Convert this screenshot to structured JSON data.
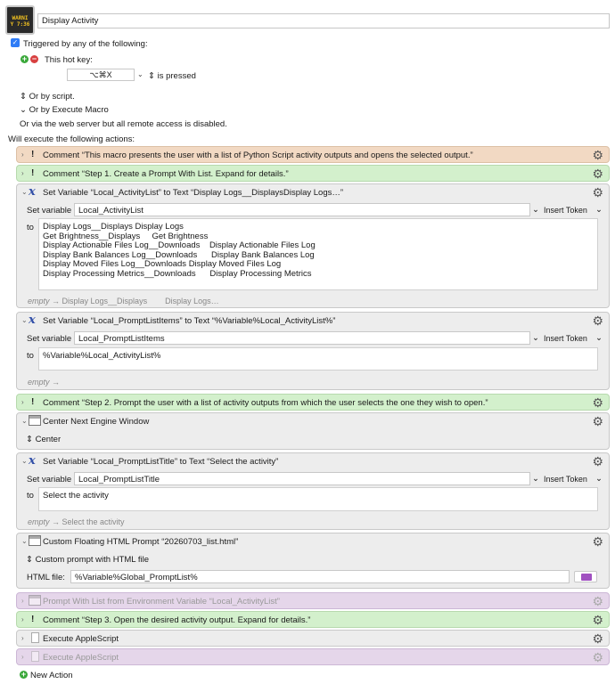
{
  "macro": {
    "icon_text_line1": "WARNI",
    "icon_text_line2": "Y 7:36",
    "name": "Display Activity"
  },
  "triggers": {
    "triggered_label": "Triggered by any of the following:",
    "hotkey_label": "This hot key:",
    "hotkey_value": "⌥⌘X",
    "hotkey_mode": "is pressed",
    "by_script": "Or by script.",
    "by_execute_macro": "Or by Execute Macro",
    "web_server": "Or via the web server but all remote access is disabled.",
    "will_execute": "Will execute the following actions:"
  },
  "actions": {
    "a1": {
      "title": "Comment “This macro presents the user with a list of Python Script activity outputs and opens the selected output.”"
    },
    "a2": {
      "title": "Comment “Step 1. Create a Prompt With List. Expand for details.”"
    },
    "a3": {
      "title": "Set Variable “Local_ActivityList” to Text “Display Logs__DisplaysDisplay Logs…”",
      "set_variable_label": "Set variable",
      "variable": "Local_ActivityList",
      "insert_token": "Insert Token",
      "to_label": "to",
      "text": "Display Logs__Displays Display Logs\nGet Brightness__Displays     Get Brightness\nDisplay Actionable Files Log__Downloads    Display Actionable Files Log\nDisplay Bank Balances Log__Downloads      Display Bank Balances Log\nDisplay Moved Files Log__Downloads Display Moved Files Log\nDisplay Processing Metrics__Downloads      Display Processing Metrics",
      "empty_label": "empty",
      "preview": " → Display Logs__Displays        Display Logs…"
    },
    "a4": {
      "title": "Set Variable “Local_PromptListItems” to Text “%Variable%Local_ActivityList%”",
      "set_variable_label": "Set variable",
      "variable": "Local_PromptListItems",
      "insert_token": "Insert Token",
      "to_label": "to",
      "text": "%Variable%Local_ActivityList%",
      "empty_label": "empty",
      "preview": " →"
    },
    "a5": {
      "title": "Comment “Step 2. Prompt the user with a list of activity outputs from which the user selects the one they wish to open.”"
    },
    "a6": {
      "title": "Center Next Engine Window",
      "option": "Center"
    },
    "a7": {
      "title": "Set Variable “Local_PromptListTitle” to Text “Select the activity”",
      "set_variable_label": "Set variable",
      "variable": "Local_PromptListTitle",
      "insert_token": "Insert Token",
      "to_label": "to",
      "text": "Select the activity",
      "empty_label": "empty",
      "preview": " → Select the activity"
    },
    "a8": {
      "title": "Custom Floating HTML Prompt “20260703_list.html”",
      "mode": "Custom prompt with HTML file",
      "html_file_label": "HTML file:",
      "html_file": "%Variable%Global_PromptList%"
    },
    "a9": {
      "title": "Prompt With List from Environment Variable “Local_ActivityList”"
    },
    "a10": {
      "title": "Comment “Step 3. Open the desired activity output. Expand for details.”"
    },
    "a11": {
      "title": "Execute AppleScript"
    },
    "a12": {
      "title": "Execute AppleScript"
    }
  },
  "new_action": "New Action"
}
